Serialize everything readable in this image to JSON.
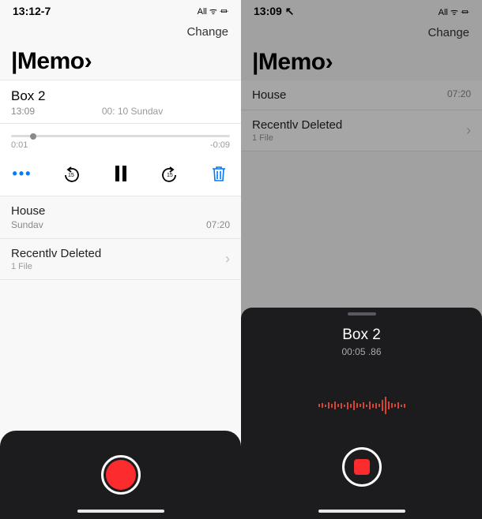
{
  "left": {
    "status": {
      "time": "13:12-7",
      "indicators": "All ᯤ ⏛"
    },
    "topAction": "Change",
    "title": "|Memo›",
    "expanded": {
      "name": "Box 2",
      "timeLabel": "13:09",
      "centerLabel": "00: 10 Sundav",
      "durationLabel": "",
      "sliderStart": "0:01",
      "sliderEnd": "-0:09"
    },
    "items": [
      {
        "name": "House",
        "date": "Sundav",
        "duration": "07:20"
      }
    ],
    "folder": {
      "name": "Recentlv Deleted",
      "sub": "1 File"
    }
  },
  "right": {
    "status": {
      "time": "13:09 ↖",
      "indicators": "All ᯤ ⏛"
    },
    "topAction": "Change",
    "title": "|Memo›",
    "items": [
      {
        "name": "House",
        "date": "",
        "duration": "07:20"
      }
    ],
    "folder": {
      "name": "Recentlv Deleted",
      "sub": "1 File"
    },
    "recording": {
      "name": "Box 2",
      "timer": "00:05 .86"
    }
  },
  "colors": {
    "accent": "#007aff",
    "record": "#fc2b2d"
  }
}
